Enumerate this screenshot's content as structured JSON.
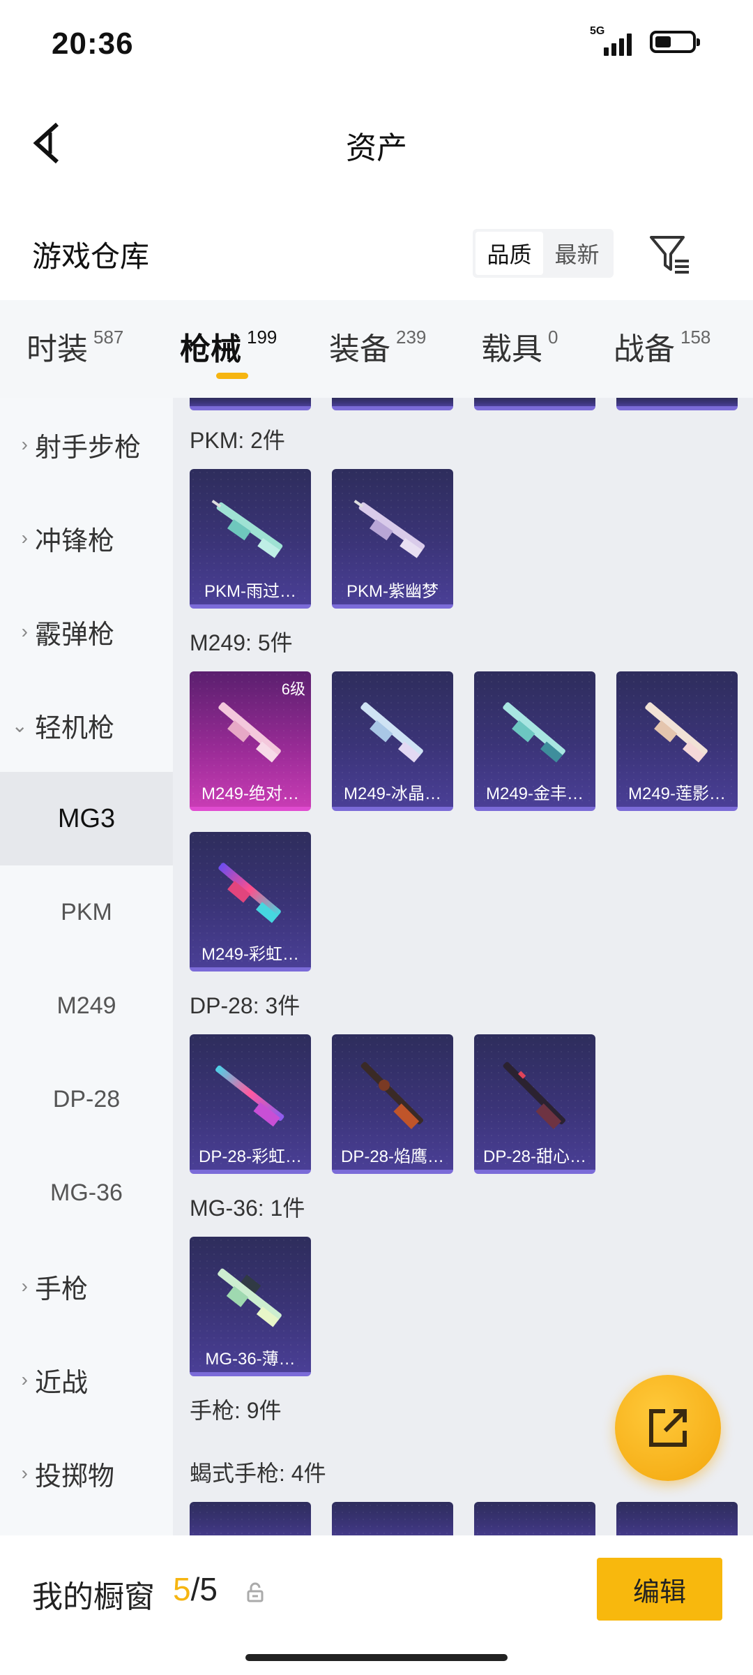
{
  "status_bar": {
    "time": "20:36",
    "network": "5G",
    "signal_bars": 4,
    "battery_level": 0.4
  },
  "header": {
    "title": "资产",
    "back_icon": "chevron-left-icon"
  },
  "warehouse": {
    "title": "游戏仓库",
    "sort_options": [
      "品质",
      "最新"
    ],
    "sort_selected": "品质",
    "filter_icon": "filter-icon"
  },
  "category_tabs": [
    {
      "label": "时装",
      "count": "587"
    },
    {
      "label": "枪械",
      "count": "199",
      "active": true
    },
    {
      "label": "装备",
      "count": "239"
    },
    {
      "label": "载具",
      "count": "0"
    },
    {
      "label": "战备",
      "count": "158"
    }
  ],
  "sidebar": {
    "items": [
      {
        "label": "射手步枪",
        "type": "group",
        "chevron": "›"
      },
      {
        "label": "冲锋枪",
        "type": "group",
        "chevron": "›"
      },
      {
        "label": "霰弹枪",
        "type": "group",
        "chevron": "›"
      },
      {
        "label": "轻机枪",
        "type": "group",
        "chevron": "⌄",
        "expanded": true
      },
      {
        "label": "MG3",
        "type": "sub",
        "selected": true
      },
      {
        "label": "PKM",
        "type": "sub"
      },
      {
        "label": "M249",
        "type": "sub"
      },
      {
        "label": "DP-28",
        "type": "sub"
      },
      {
        "label": "MG-36",
        "type": "sub"
      },
      {
        "label": "手枪",
        "type": "group",
        "chevron": "›"
      },
      {
        "label": "近战",
        "type": "group",
        "chevron": "›"
      },
      {
        "label": "投掷物",
        "type": "group",
        "chevron": "›"
      }
    ]
  },
  "sections": [
    {
      "label": "PKM: 2件",
      "items": [
        {
          "name": "PKM-雨过…"
        },
        {
          "name": "PKM-紫幽梦"
        }
      ]
    },
    {
      "label": "M249: 5件",
      "items": [
        {
          "name": "M249-绝对…",
          "level": "6级",
          "highlight": true
        },
        {
          "name": "M249-冰晶…"
        },
        {
          "name": "M249-金丰…"
        },
        {
          "name": "M249-莲影…"
        },
        {
          "name": "M249-彩虹…"
        }
      ]
    },
    {
      "label": "DP-28: 3件",
      "items": [
        {
          "name": "DP-28-彩虹…"
        },
        {
          "name": "DP-28-焰鹰…"
        },
        {
          "name": "DP-28-甜心…"
        }
      ]
    },
    {
      "label": "MG-36: 1件",
      "items": [
        {
          "name": "MG-36-薄…"
        }
      ]
    },
    {
      "label": "手枪: 9件",
      "items": []
    },
    {
      "label": "蝎式手枪: 4件",
      "items": []
    }
  ],
  "fab": {
    "icon": "share-icon"
  },
  "bottom_bar": {
    "showcase_label": "我的橱窗",
    "showcase_current": "5",
    "showcase_total": "/5",
    "lock_icon": "lock-icon",
    "edit_label": "编辑"
  },
  "colors": {
    "accent": "#f6b511",
    "card_purple": "#3b3478",
    "card_pink": "#c83cb4"
  }
}
